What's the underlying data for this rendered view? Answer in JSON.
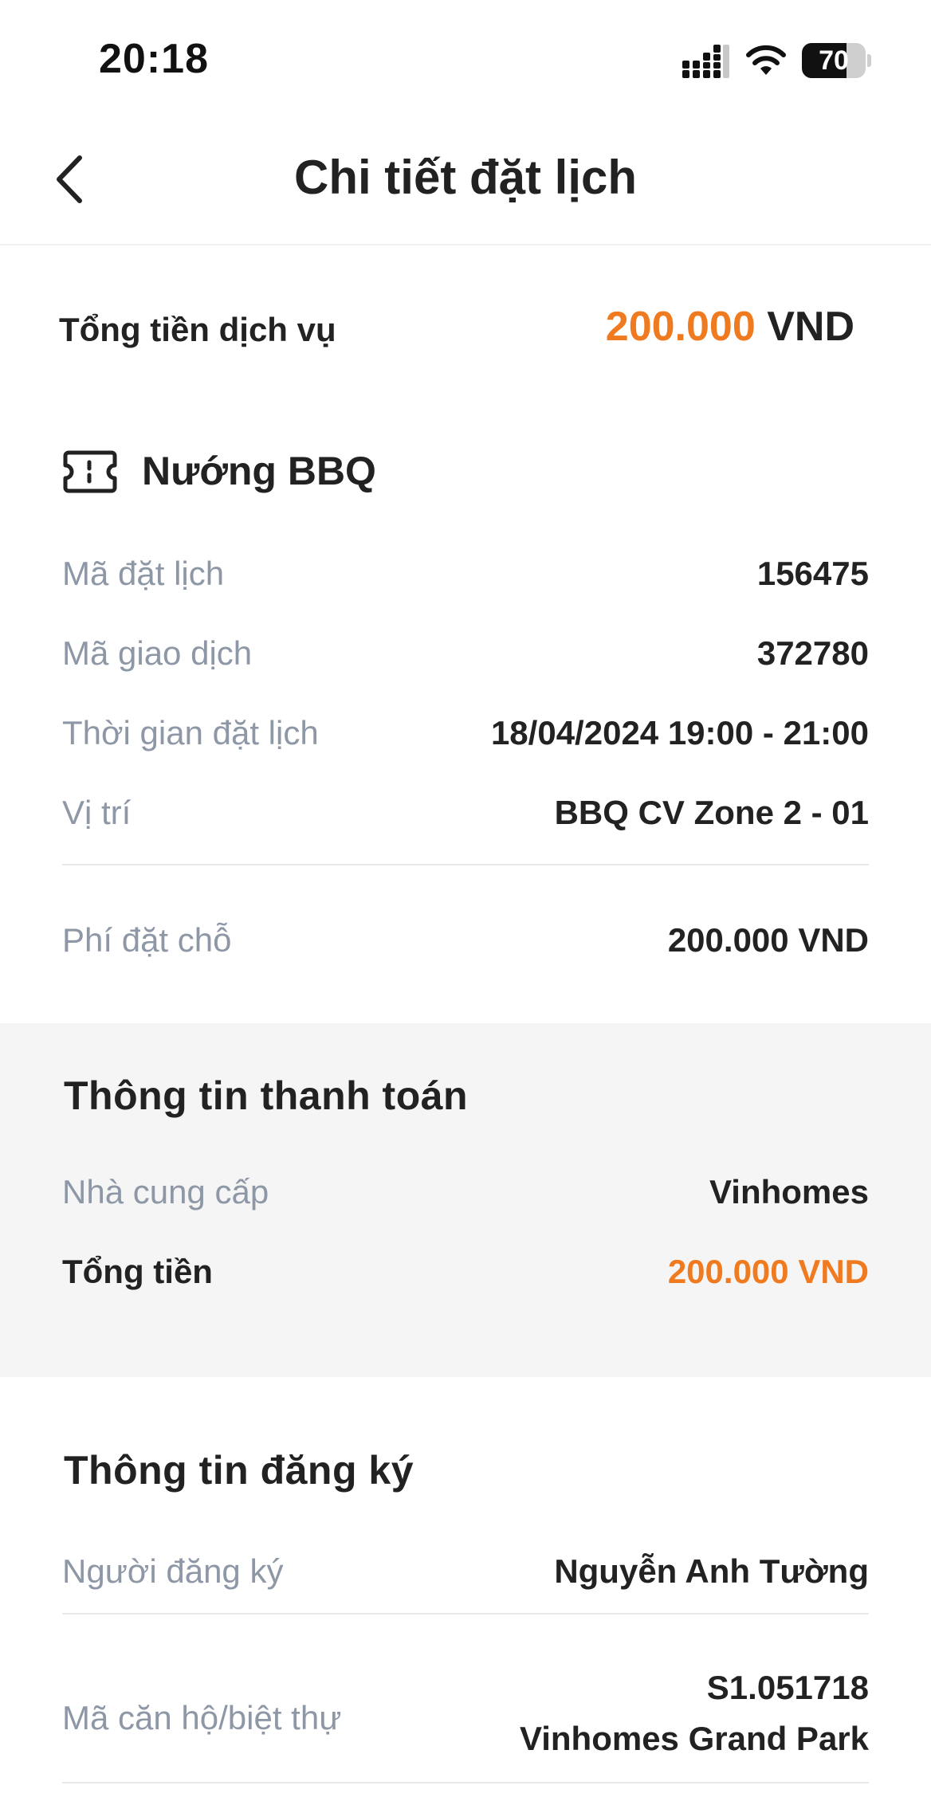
{
  "status_bar": {
    "time": "20:18",
    "battery": "70",
    "battery_level": 0.7,
    "icons": [
      "signal-icon",
      "wifi-icon",
      "battery-icon"
    ]
  },
  "nav": {
    "title": "Chi tiết đặt lịch",
    "back_icon": "chevron-left-icon"
  },
  "summary": {
    "label": "Tổng tiền dịch vụ",
    "amount": "200.000",
    "currency": "VND"
  },
  "service": {
    "icon": "ticket-icon",
    "name": "Nướng BBQ",
    "rows": [
      {
        "label": "Mã đặt lịch",
        "value": "156475"
      },
      {
        "label": "Mã giao dịch",
        "value": "372780"
      },
      {
        "label": "Thời gian đặt lịch",
        "value": "18/04/2024 19:00 - 21:00"
      },
      {
        "label": "Vị trí",
        "value": "BBQ CV Zone 2 - 01"
      }
    ],
    "fee": {
      "label": "Phí đặt chỗ",
      "value": "200.000 VND"
    }
  },
  "payment": {
    "title": "Thông tin thanh toán",
    "provider": {
      "label": "Nhà cung cấp",
      "value": "Vinhomes"
    },
    "total": {
      "label": "Tổng tiền",
      "value": "200.000 VND"
    }
  },
  "registration": {
    "title": "Thông tin đăng ký",
    "registrant": {
      "label": "Người đăng ký",
      "value": "Nguyễn Anh Tường"
    },
    "unit": {
      "label": "Mã căn hộ/biệt thự",
      "value_line1": "S1.051718",
      "value_line2": "Vinhomes Grand Park"
    }
  },
  "colors": {
    "accent": "#f07a1f",
    "label_gray": "#8d97a6",
    "section_bg": "#f5f5f5"
  }
}
